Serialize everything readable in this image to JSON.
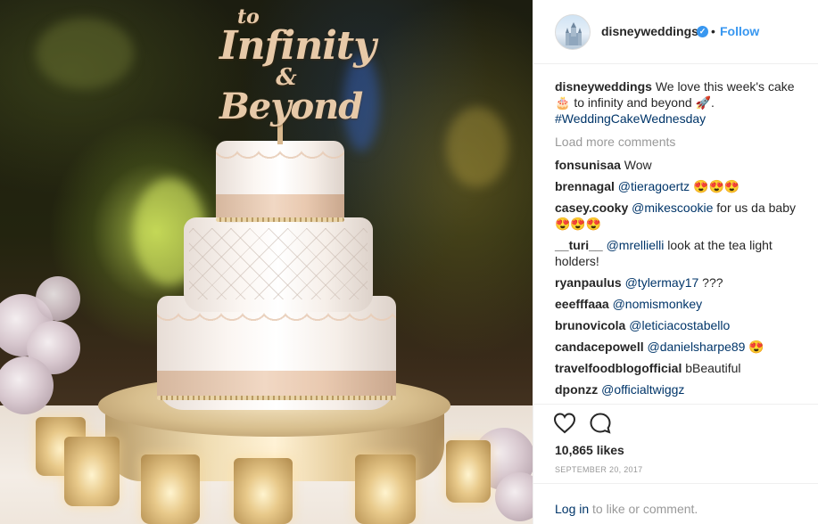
{
  "photo": {
    "description_icon": "wedding-cake-photo",
    "topper": {
      "line1": "to",
      "line2": "Infinity",
      "line3": "&",
      "line4": "Beyond"
    }
  },
  "header": {
    "username": "disneyweddings",
    "verified_icon": "verified-badge-icon",
    "separator": "•",
    "follow_label": "Follow"
  },
  "caption": {
    "user": "disneyweddings",
    "text": "We love this week's cake 🎂 to infinity and beyond 🚀.",
    "hashtag": "#WeddingCakeWednesday"
  },
  "load_more": "Load more comments",
  "comments": [
    {
      "user": "fonsunisaa",
      "mention": "",
      "text": "Wow"
    },
    {
      "user": "brennagal",
      "mention": "@tieragoertz",
      "text": "😍😍😍"
    },
    {
      "user": "casey.cooky",
      "mention": "@mikescookie",
      "text": "for us da baby 😍😍😍"
    },
    {
      "user": "__turi__",
      "mention": "@mrellielli",
      "text": "look at the tea light holders!"
    },
    {
      "user": "ryanpaulus",
      "mention": "@tylermay17",
      "text": "???"
    },
    {
      "user": "eeefffaaa",
      "mention": "@nomismonkey",
      "text": ""
    },
    {
      "user": "brunovicola",
      "mention": "@leticiacostabello",
      "text": ""
    },
    {
      "user": "candacepowell",
      "mention": "@danielsharpe89",
      "text": "😍"
    },
    {
      "user": "travelfoodblogofficial",
      "mention": "",
      "text": "bBeautiful"
    },
    {
      "user": "dponzz",
      "mention": "@officialtwiggz",
      "text": ""
    }
  ],
  "actions": {
    "like_icon": "heart-icon",
    "comment_icon": "comment-bubble-icon",
    "likes": "10,865 likes",
    "date": "SEPTEMBER 20, 2017"
  },
  "login": {
    "link": "Log in",
    "text": "to like or comment."
  },
  "colors": {
    "link_blue": "#3897f0",
    "mention_blue": "#003569",
    "muted": "#999999",
    "text": "#262626"
  }
}
